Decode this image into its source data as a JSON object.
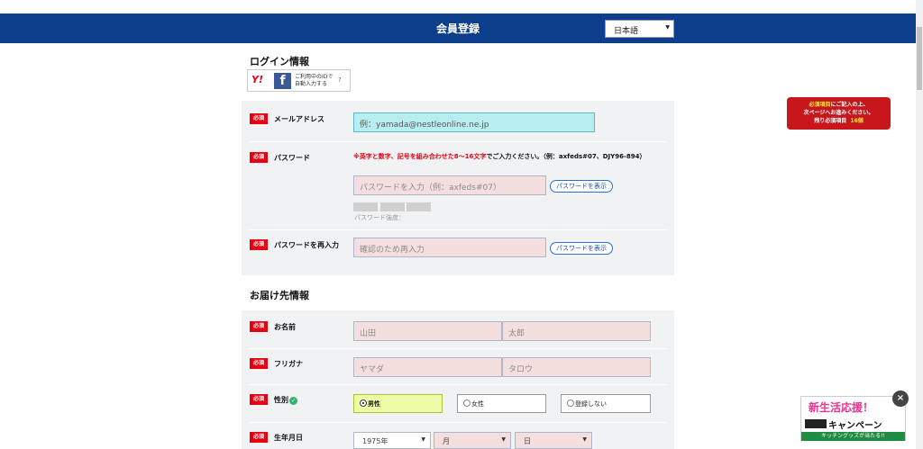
{
  "header": {
    "title": "会員登録",
    "language": "日本語"
  },
  "login_section": {
    "heading": "ログイン情報",
    "social": {
      "yahoo": "Y!",
      "facebook": "f",
      "text_line1": "ご利用中のIDで",
      "text_line2": "自動入力する",
      "help": "?"
    }
  },
  "required_label": "必須",
  "email": {
    "label": "メールアドレス",
    "placeholder": "例：yamada@nestleonline.ne.jp"
  },
  "password": {
    "label": "パスワード",
    "note_red": "※英字と数字、記号を組み合わせた8〜16文字",
    "note_rest": "でご入力ください。（例：axfeds#07、DJY96-894）",
    "placeholder": "パスワードを入力（例：axfeds#07）",
    "show_label": "パスワードを表示",
    "strength_label": "パスワード強度："
  },
  "password_confirm": {
    "label": "パスワードを再入力",
    "placeholder": "確認のため再入力",
    "show_label": "パスワードを表示"
  },
  "delivery_section": {
    "heading": "お届け先情報"
  },
  "name": {
    "label": "お名前",
    "last_placeholder": "山田",
    "first_placeholder": "太郎"
  },
  "furigana": {
    "label": "フリガナ",
    "last_placeholder": "ヤマダ",
    "first_placeholder": "タロウ"
  },
  "gender": {
    "label": "性別",
    "options": [
      "男性",
      "女性",
      "登録しない"
    ],
    "selected": "男性"
  },
  "birth": {
    "label": "生年月日",
    "year": "1975年",
    "month": "月",
    "day": "日"
  },
  "notice": {
    "line1_yellow": "必須項目",
    "line1_rest": "にご記入の上、",
    "line2": "次ページへお進みください。",
    "line3": "残り必須項目",
    "remaining": "16個"
  },
  "banner": {
    "title": "新生活応援！",
    "subtitle": "キャンペーン",
    "footer": "キッチングッズが当たる!!",
    "close": "×"
  }
}
